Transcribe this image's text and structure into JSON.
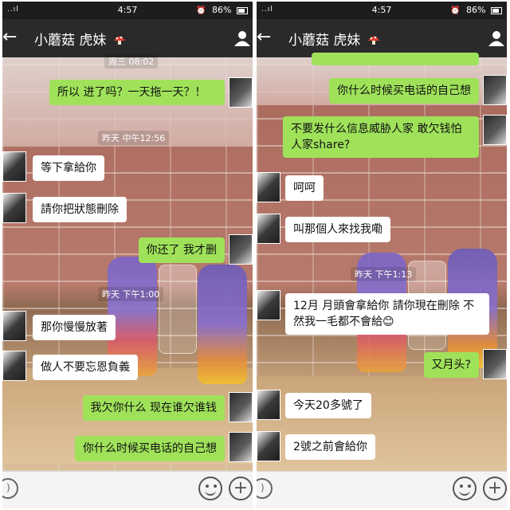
{
  "status_bar": {
    "signal": "..ıl",
    "time": "4:57",
    "alarm": "⏰",
    "battery": "86%"
  },
  "chat": {
    "title": "小蘑菇    虎妹",
    "back_icon": "back-arrow-icon",
    "profile_icon": "person-icon"
  },
  "left_panel": {
    "messages": [
      {
        "type": "timestamp",
        "text": "周三 08:02"
      },
      {
        "type": "out",
        "text": "所以 进了吗？一天拖一天？！"
      },
      {
        "type": "timestamp",
        "text": "昨天 中午12:56"
      },
      {
        "type": "in",
        "text": "等下拿給你"
      },
      {
        "type": "in",
        "text": "請你把狀態刪除"
      },
      {
        "type": "out",
        "text": "你还了 我才删"
      },
      {
        "type": "timestamp",
        "text": "昨天 下午1:00"
      },
      {
        "type": "in",
        "text": "那你慢慢放著"
      },
      {
        "type": "in",
        "text": "做人不要忘恩負義"
      },
      {
        "type": "out",
        "text": "我欠你什么 现在谁欠谁钱"
      },
      {
        "type": "out",
        "text": "你什么时候买电话的自己想"
      }
    ]
  },
  "right_panel": {
    "messages": [
      {
        "type": "out",
        "text": "你什么时候买电话的自己想"
      },
      {
        "type": "out",
        "text": "不要发什么信息威胁人家 敢欠钱怕人家share?"
      },
      {
        "type": "in",
        "text": "呵呵"
      },
      {
        "type": "in",
        "text": "叫那個人來找我嘞"
      },
      {
        "type": "timestamp",
        "text": "昨天 下午1:13"
      },
      {
        "type": "in",
        "text": "12月 月頭會拿給你 請你現在刪除 不然我一毛都不會給😊"
      },
      {
        "type": "out",
        "text": "又月头?"
      },
      {
        "type": "in",
        "text": "今天20多號了"
      },
      {
        "type": "in",
        "text": "2號之前會給你"
      }
    ]
  },
  "input_bar": {
    "voice_icon": "voice-icon",
    "emoji_icon": "emoji-icon",
    "plus_icon": "plus-icon"
  },
  "colors": {
    "outgoing_bubble": "#9fe25a",
    "incoming_bubble": "#ffffff",
    "title_bar": "#2a2a2a",
    "status_bar": "#1d1d1d"
  }
}
